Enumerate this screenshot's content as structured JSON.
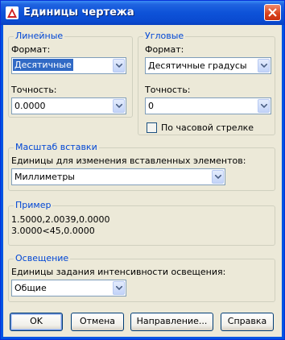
{
  "window": {
    "title": "Единицы чертежа"
  },
  "linear": {
    "legend": "Линейные",
    "format_label": "Формат:",
    "format_value": "Десятичные",
    "precision_label": "Точность:",
    "precision_value": "0.0000"
  },
  "angular": {
    "legend": "Угловые",
    "format_label": "Формат:",
    "format_value": "Десятичные градусы",
    "precision_label": "Точность:",
    "precision_value": "0",
    "clockwise_label": "По часовой стрелке",
    "clockwise_checked": false
  },
  "insertion": {
    "legend": "Масштаб вставки",
    "units_label": "Единицы для изменения вставленных элементов:",
    "units_value": "Миллиметры"
  },
  "sample": {
    "legend": "Пример",
    "line1": "1.5000,2.0039,0.0000",
    "line2": "3.0000<45,0.0000"
  },
  "lighting": {
    "legend": "Освещение",
    "units_label": "Единицы задания интенсивности освещения:",
    "units_value": "Общие"
  },
  "buttons": {
    "ok": "OK",
    "cancel": "Отмена",
    "direction": "Направление...",
    "help": "Справка"
  },
  "colors": {
    "accent": "#0046d5",
    "titlebar": "#0a4ad0",
    "dialog_bg": "#ece9d8"
  }
}
